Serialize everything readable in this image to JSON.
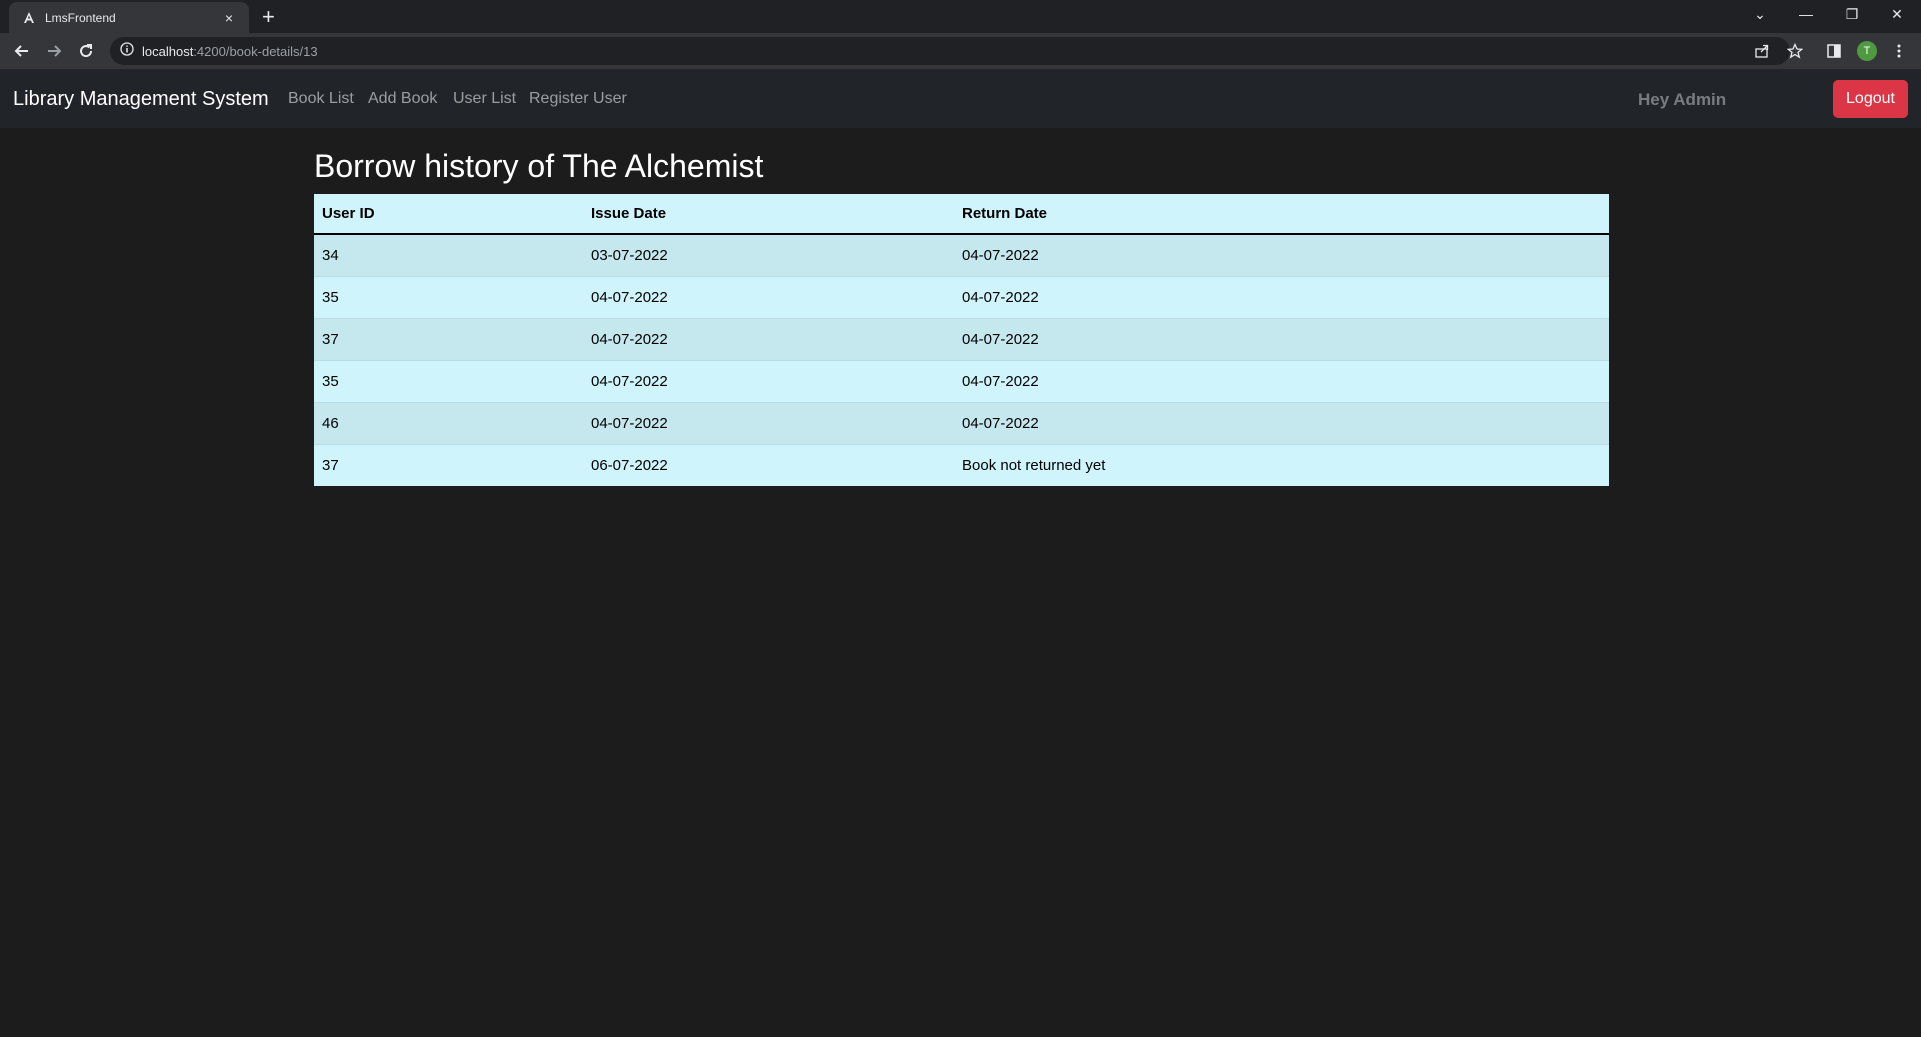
{
  "browser": {
    "tab_title": "LmsFrontend",
    "tab_close": "×",
    "new_tab": "+",
    "url_host": "localhost",
    "url_rest": ":4200/book-details/13",
    "profile_initial": "T",
    "window_controls": [
      "⌄",
      "—",
      "❐",
      "✕"
    ]
  },
  "navbar": {
    "brand": "Library Management System",
    "links": [
      "Book List",
      "Add Book",
      "User List",
      "Register User"
    ],
    "greeting": "Hey Admin",
    "logout_label": "Logout"
  },
  "page": {
    "title": "Borrow history of The Alchemist"
  },
  "table": {
    "headers": [
      "User ID",
      "Issue Date",
      "Return Date"
    ],
    "rows": [
      [
        "34",
        "03-07-2022",
        "04-07-2022"
      ],
      [
        "35",
        "04-07-2022",
        "04-07-2022"
      ],
      [
        "37",
        "04-07-2022",
        "04-07-2022"
      ],
      [
        "35",
        "04-07-2022",
        "04-07-2022"
      ],
      [
        "46",
        "04-07-2022",
        "04-07-2022"
      ],
      [
        "37",
        "06-07-2022",
        "Book not returned yet"
      ]
    ]
  },
  "colors": {
    "accent_danger": "#dc3545",
    "table_info": "#cff4fc",
    "background": "#1c1c1c",
    "navbar": "#212529"
  }
}
